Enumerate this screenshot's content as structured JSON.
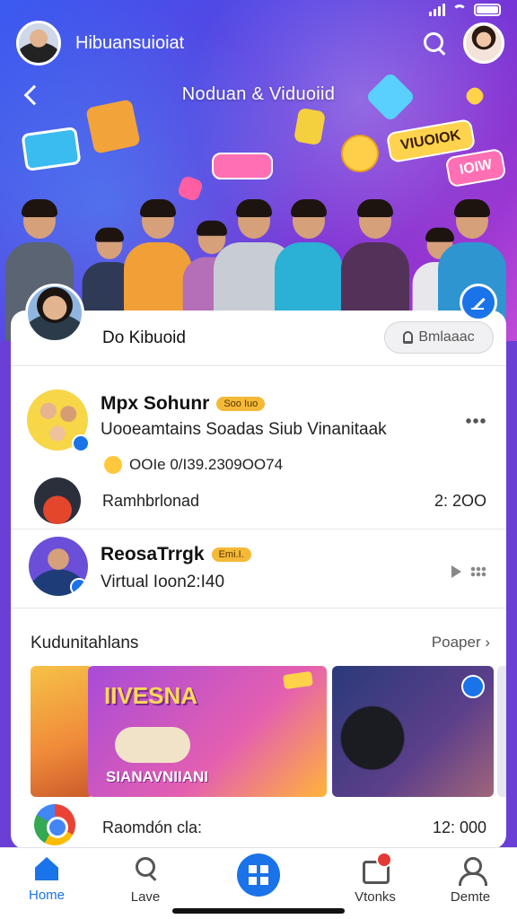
{
  "header": {
    "app_title": "Hibuansuioiat",
    "hero_title": "Noduan & Viduoiid"
  },
  "hero_stickers": {
    "pill_a": "VIUOIOK",
    "pill_b": "IOIW"
  },
  "channel": {
    "name": "Do Kibuoid",
    "subscribe_label": "Bmlaaac"
  },
  "posts": [
    {
      "title": "Mpx Sohunr",
      "tag": "Soo Iuo",
      "subtitle": "Uooeamtains Soadas Siub Vinanitaak",
      "meta": "OOIe 0/I39.2309OO74"
    },
    {
      "title": "ReosaTrrgk",
      "tag": "Emi.I.",
      "subtitle": "Virtual Ioon2:I40"
    }
  ],
  "rows": [
    {
      "label": "Ramhbrlonad",
      "value": "2: 2OO"
    },
    {
      "label": "Raomdón cla:",
      "value": "12: 000"
    }
  ],
  "section": {
    "title": "Kudunitahlans",
    "link": "Poaper"
  },
  "media": {
    "title": "IIVESNA",
    "caption": "SIANAVNIIANI"
  },
  "tabs": [
    {
      "label": "Home"
    },
    {
      "label": "Lave"
    },
    {
      "label": ""
    },
    {
      "label": "Vtonks"
    },
    {
      "label": "Demte"
    }
  ],
  "colors": {
    "accent": "#1a73e8",
    "badge": "#f5b938",
    "notification": "#e53935"
  }
}
